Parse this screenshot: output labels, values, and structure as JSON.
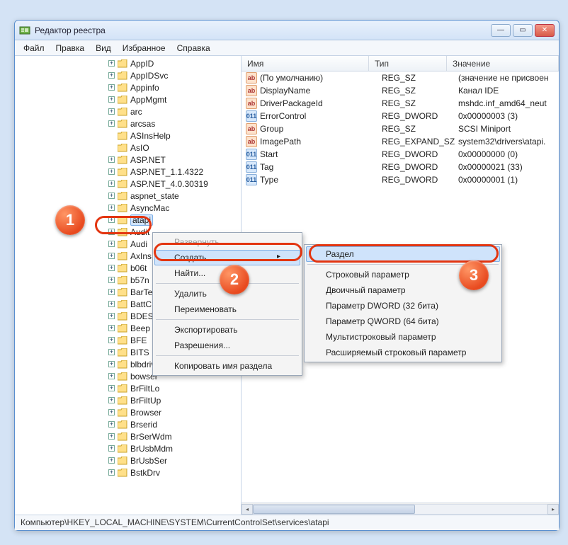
{
  "window": {
    "title": "Редактор реестра"
  },
  "menu": {
    "file": "Файл",
    "edit": "Правка",
    "view": "Вид",
    "favorites": "Избранное",
    "help": "Справка"
  },
  "tree": {
    "items": [
      {
        "label": "AppID",
        "expand": "+"
      },
      {
        "label": "AppIDSvc",
        "expand": "+"
      },
      {
        "label": "Appinfo",
        "expand": "+"
      },
      {
        "label": "AppMgmt",
        "expand": "+"
      },
      {
        "label": "arc",
        "expand": "+"
      },
      {
        "label": "arcsas",
        "expand": "+"
      },
      {
        "label": "ASInsHelp",
        "expand": ""
      },
      {
        "label": "AsIO",
        "expand": ""
      },
      {
        "label": "ASP.NET",
        "expand": "+"
      },
      {
        "label": "ASP.NET_1.1.4322",
        "expand": "+"
      },
      {
        "label": "ASP.NET_4.0.30319",
        "expand": "+"
      },
      {
        "label": "aspnet_state",
        "expand": "+"
      },
      {
        "label": "AsyncMac"
      },
      {
        "label": "atapi",
        "selected": true,
        "expand": "+"
      },
      {
        "label": "Audit",
        "expand": "+"
      },
      {
        "label": "Audi",
        "expand": "+"
      },
      {
        "label": "AxIns",
        "expand": "+"
      },
      {
        "label": "b06t",
        "expand": "+"
      },
      {
        "label": "b57n",
        "expand": "+"
      },
      {
        "label": "BarTe",
        "expand": "+"
      },
      {
        "label": "BattC",
        "expand": "+"
      },
      {
        "label": "BDES",
        "expand": "+"
      },
      {
        "label": "Beep",
        "expand": "+"
      },
      {
        "label": "BFE",
        "expand": "+"
      },
      {
        "label": "BITS",
        "expand": "+"
      },
      {
        "label": "blbdrive",
        "expand": "+"
      },
      {
        "label": "bowser",
        "expand": "+"
      },
      {
        "label": "BrFiltLo",
        "expand": "+"
      },
      {
        "label": "BrFiltUp",
        "expand": "+"
      },
      {
        "label": "Browser",
        "expand": "+"
      },
      {
        "label": "Brserid",
        "expand": "+"
      },
      {
        "label": "BrSerWdm",
        "expand": "+"
      },
      {
        "label": "BrUsbMdm",
        "expand": "+"
      },
      {
        "label": "BrUsbSer",
        "expand": "+"
      },
      {
        "label": "BstkDrv",
        "expand": "+"
      }
    ]
  },
  "columns": {
    "name": "Имя",
    "type": "Тип",
    "value": "Значение"
  },
  "values": [
    {
      "icon": "sz",
      "name": "(По умолчанию)",
      "type": "REG_SZ",
      "value": "(значение не присвоен"
    },
    {
      "icon": "sz",
      "name": "DisplayName",
      "type": "REG_SZ",
      "value": "Канал IDE"
    },
    {
      "icon": "sz",
      "name": "DriverPackageId",
      "type": "REG_SZ",
      "value": "mshdc.inf_amd64_neut"
    },
    {
      "icon": "dw",
      "name": "ErrorControl",
      "type": "REG_DWORD",
      "value": "0x00000003 (3)"
    },
    {
      "icon": "sz",
      "name": "Group",
      "type": "REG_SZ",
      "value": "SCSI Miniport"
    },
    {
      "icon": "sz",
      "name": "ImagePath",
      "type": "REG_EXPAND_SZ",
      "value": "system32\\drivers\\atapi."
    },
    {
      "icon": "dw",
      "name": "Start",
      "type": "REG_DWORD",
      "value": "0x00000000 (0)"
    },
    {
      "icon": "dw",
      "name": "Tag",
      "type": "REG_DWORD",
      "value": "0x00000021 (33)"
    },
    {
      "icon": "dw",
      "name": "Type",
      "type": "REG_DWORD",
      "value": "0x00000001 (1)"
    }
  ],
  "context_menu": {
    "expand": "Развернуть",
    "new": "Создать",
    "find": "Найти...",
    "delete": "Удалить",
    "rename": "Переименовать",
    "export": "Экспортировать",
    "permissions": "Разрешения...",
    "copy_key_name": "Копировать имя раздела"
  },
  "submenu": {
    "key": "Раздел",
    "string": "Строковый параметр",
    "binary": "Двоичный параметр",
    "dword": "Параметр DWORD (32 бита)",
    "qword": "Параметр QWORD (64 бита)",
    "multistring": "Мультистроковый параметр",
    "expandstring": "Расширяемый строковый параметр"
  },
  "statusbar": "Компьютер\\HKEY_LOCAL_MACHINE\\SYSTEM\\CurrentControlSet\\services\\atapi",
  "callouts": {
    "c1": "1",
    "c2": "2",
    "c3": "3"
  }
}
